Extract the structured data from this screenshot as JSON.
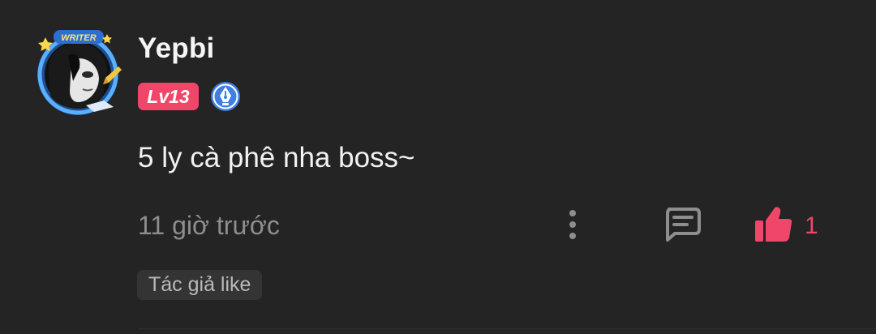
{
  "comment": {
    "author": {
      "name": "Yepbi",
      "avatar_frame_label": "WRITER",
      "level": "Lv13",
      "badge_icon": "pen-nib-icon"
    },
    "text": "5 ly cà phê nha boss~",
    "timestamp": "11 giờ trước",
    "actions": {
      "more_icon": "more-vertical-icon",
      "reply_icon": "comment-icon",
      "like_icon": "thumbs-up-icon",
      "like_count": "1"
    },
    "author_liked_tag": "Tác giả like"
  },
  "colors": {
    "background": "#242424",
    "accent": "#f0466a",
    "muted_text": "#8e8e8e",
    "tag_bg": "#343434",
    "badge_blue": "#3f7fe0"
  }
}
